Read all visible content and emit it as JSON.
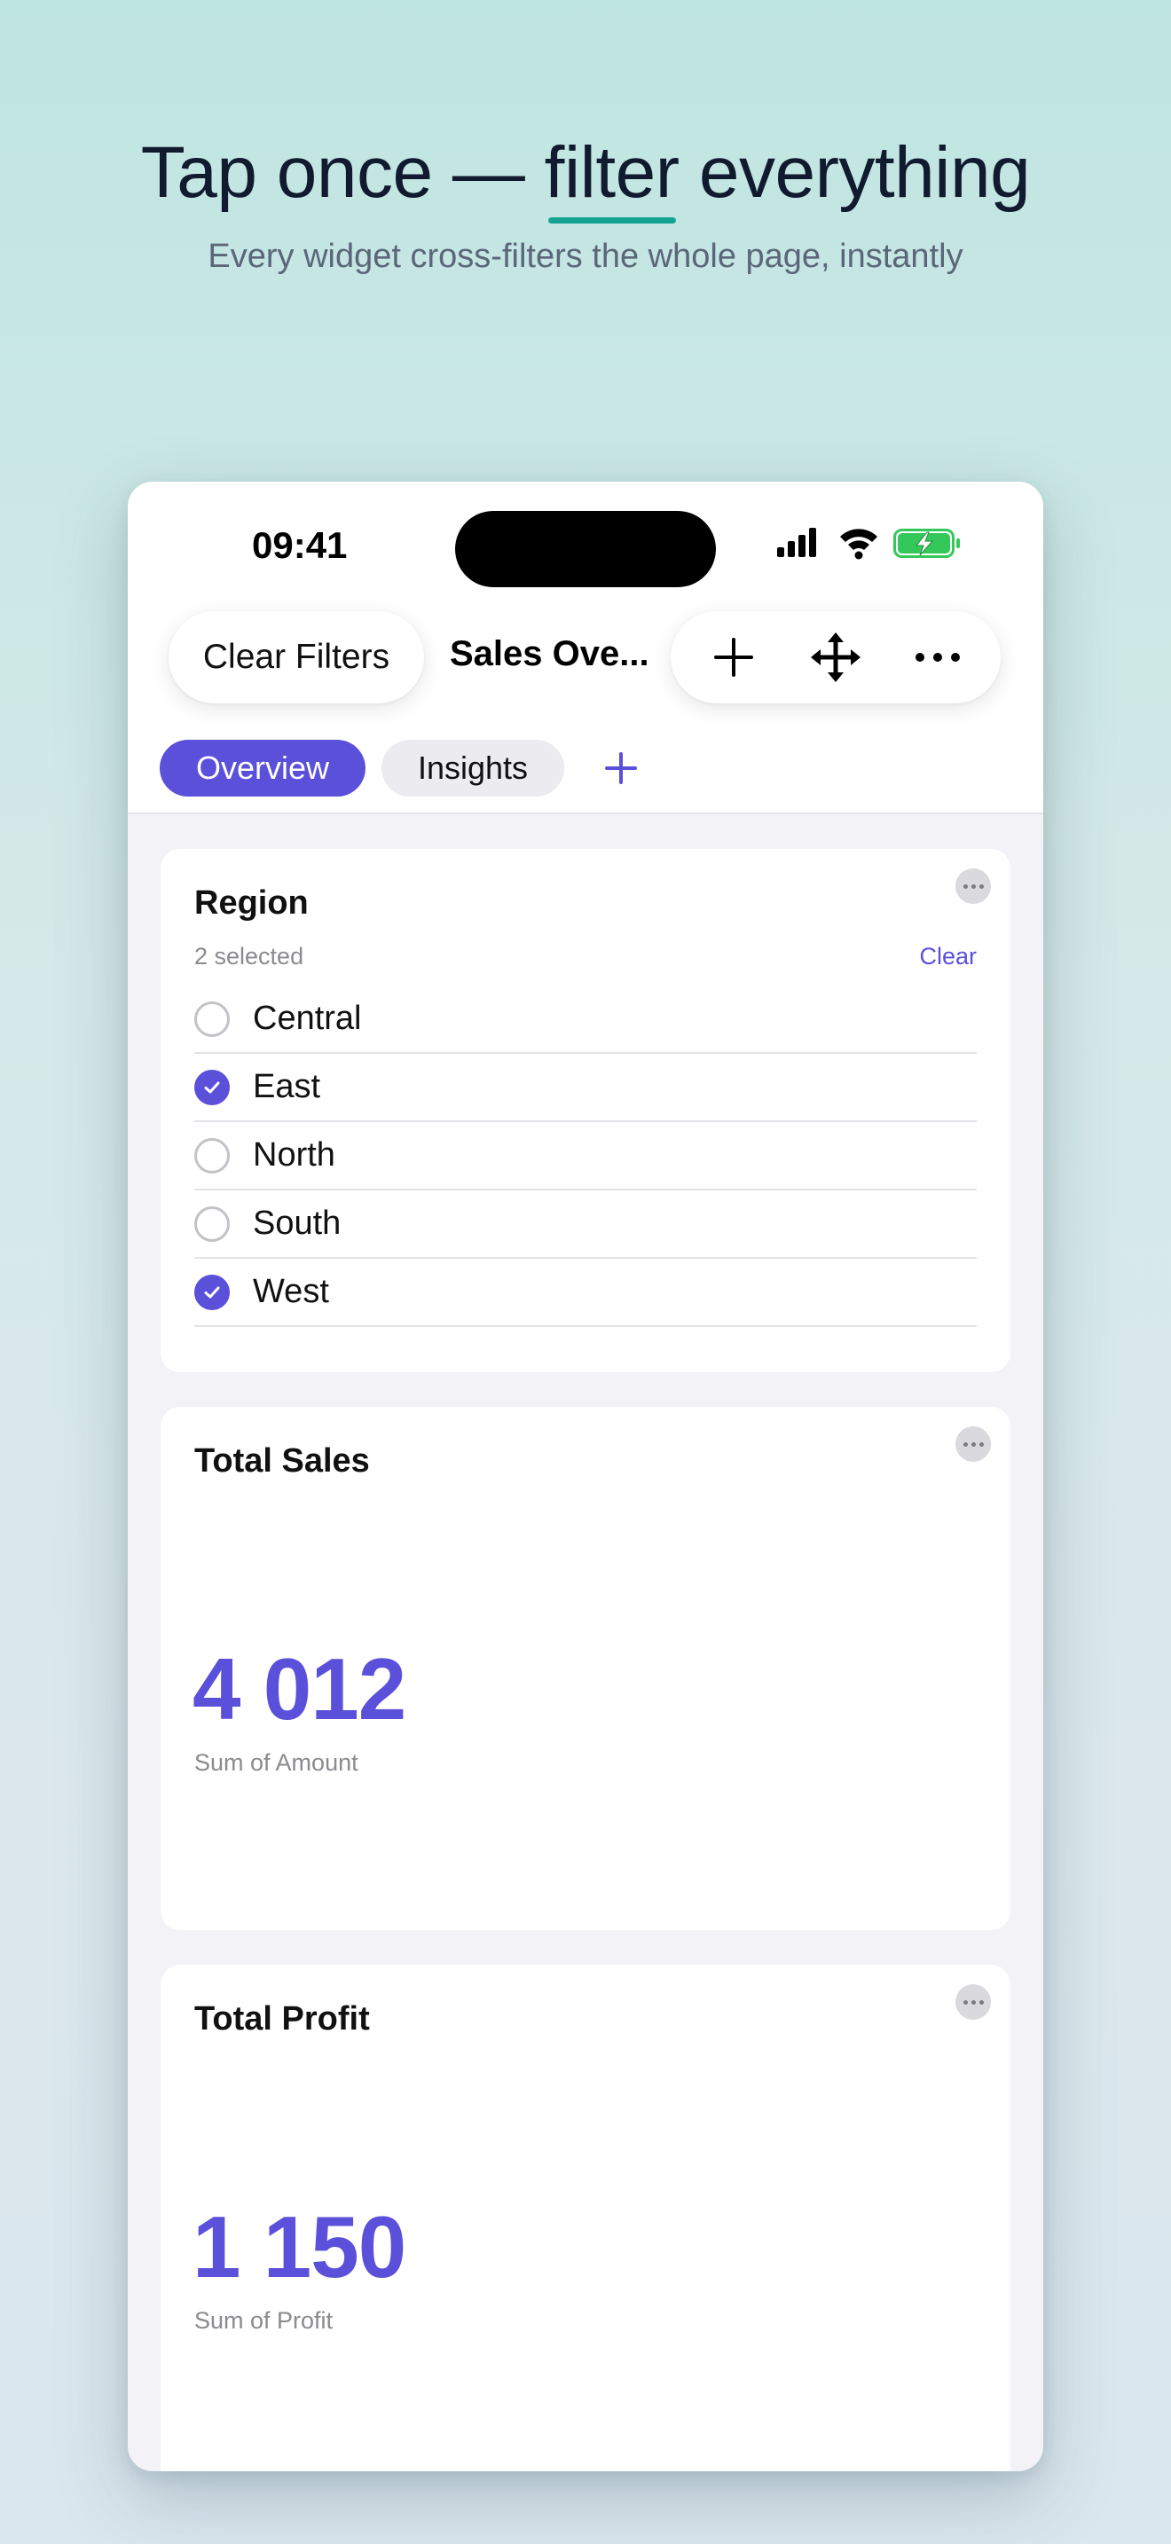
{
  "marketing": {
    "headline_before": "Tap once — ",
    "headline_highlight": "filter",
    "headline_after": " everything",
    "subheadline": "Every widget cross-filters the whole page, instantly"
  },
  "status_bar": {
    "time": "09:41",
    "icons": [
      "cellular-signal-icon",
      "wifi-icon",
      "battery-charging-icon"
    ],
    "battery_color": "#34c759"
  },
  "toolbar": {
    "clear_filters_label": "Clear Filters",
    "title": "Sales Ove...",
    "actions": [
      "plus-icon",
      "move-icon",
      "ellipsis-icon"
    ]
  },
  "tabs": [
    {
      "label": "Overview",
      "active": true
    },
    {
      "label": "Insights",
      "active": false
    }
  ],
  "region_filter": {
    "title": "Region",
    "selected_count": "2 selected",
    "clear_label": "Clear",
    "options": [
      {
        "label": "Central",
        "checked": false
      },
      {
        "label": "East",
        "checked": true
      },
      {
        "label": "North",
        "checked": false
      },
      {
        "label": "South",
        "checked": false
      },
      {
        "label": "West",
        "checked": true
      }
    ]
  },
  "total_sales": {
    "title": "Total Sales",
    "value": "4 012",
    "caption": "Sum of Amount"
  },
  "total_profit": {
    "title": "Total Profit",
    "value": "1 150",
    "caption": "Sum of Profit"
  },
  "colors": {
    "accent": "#5b50d9",
    "highlight_underline": "#15a394"
  }
}
